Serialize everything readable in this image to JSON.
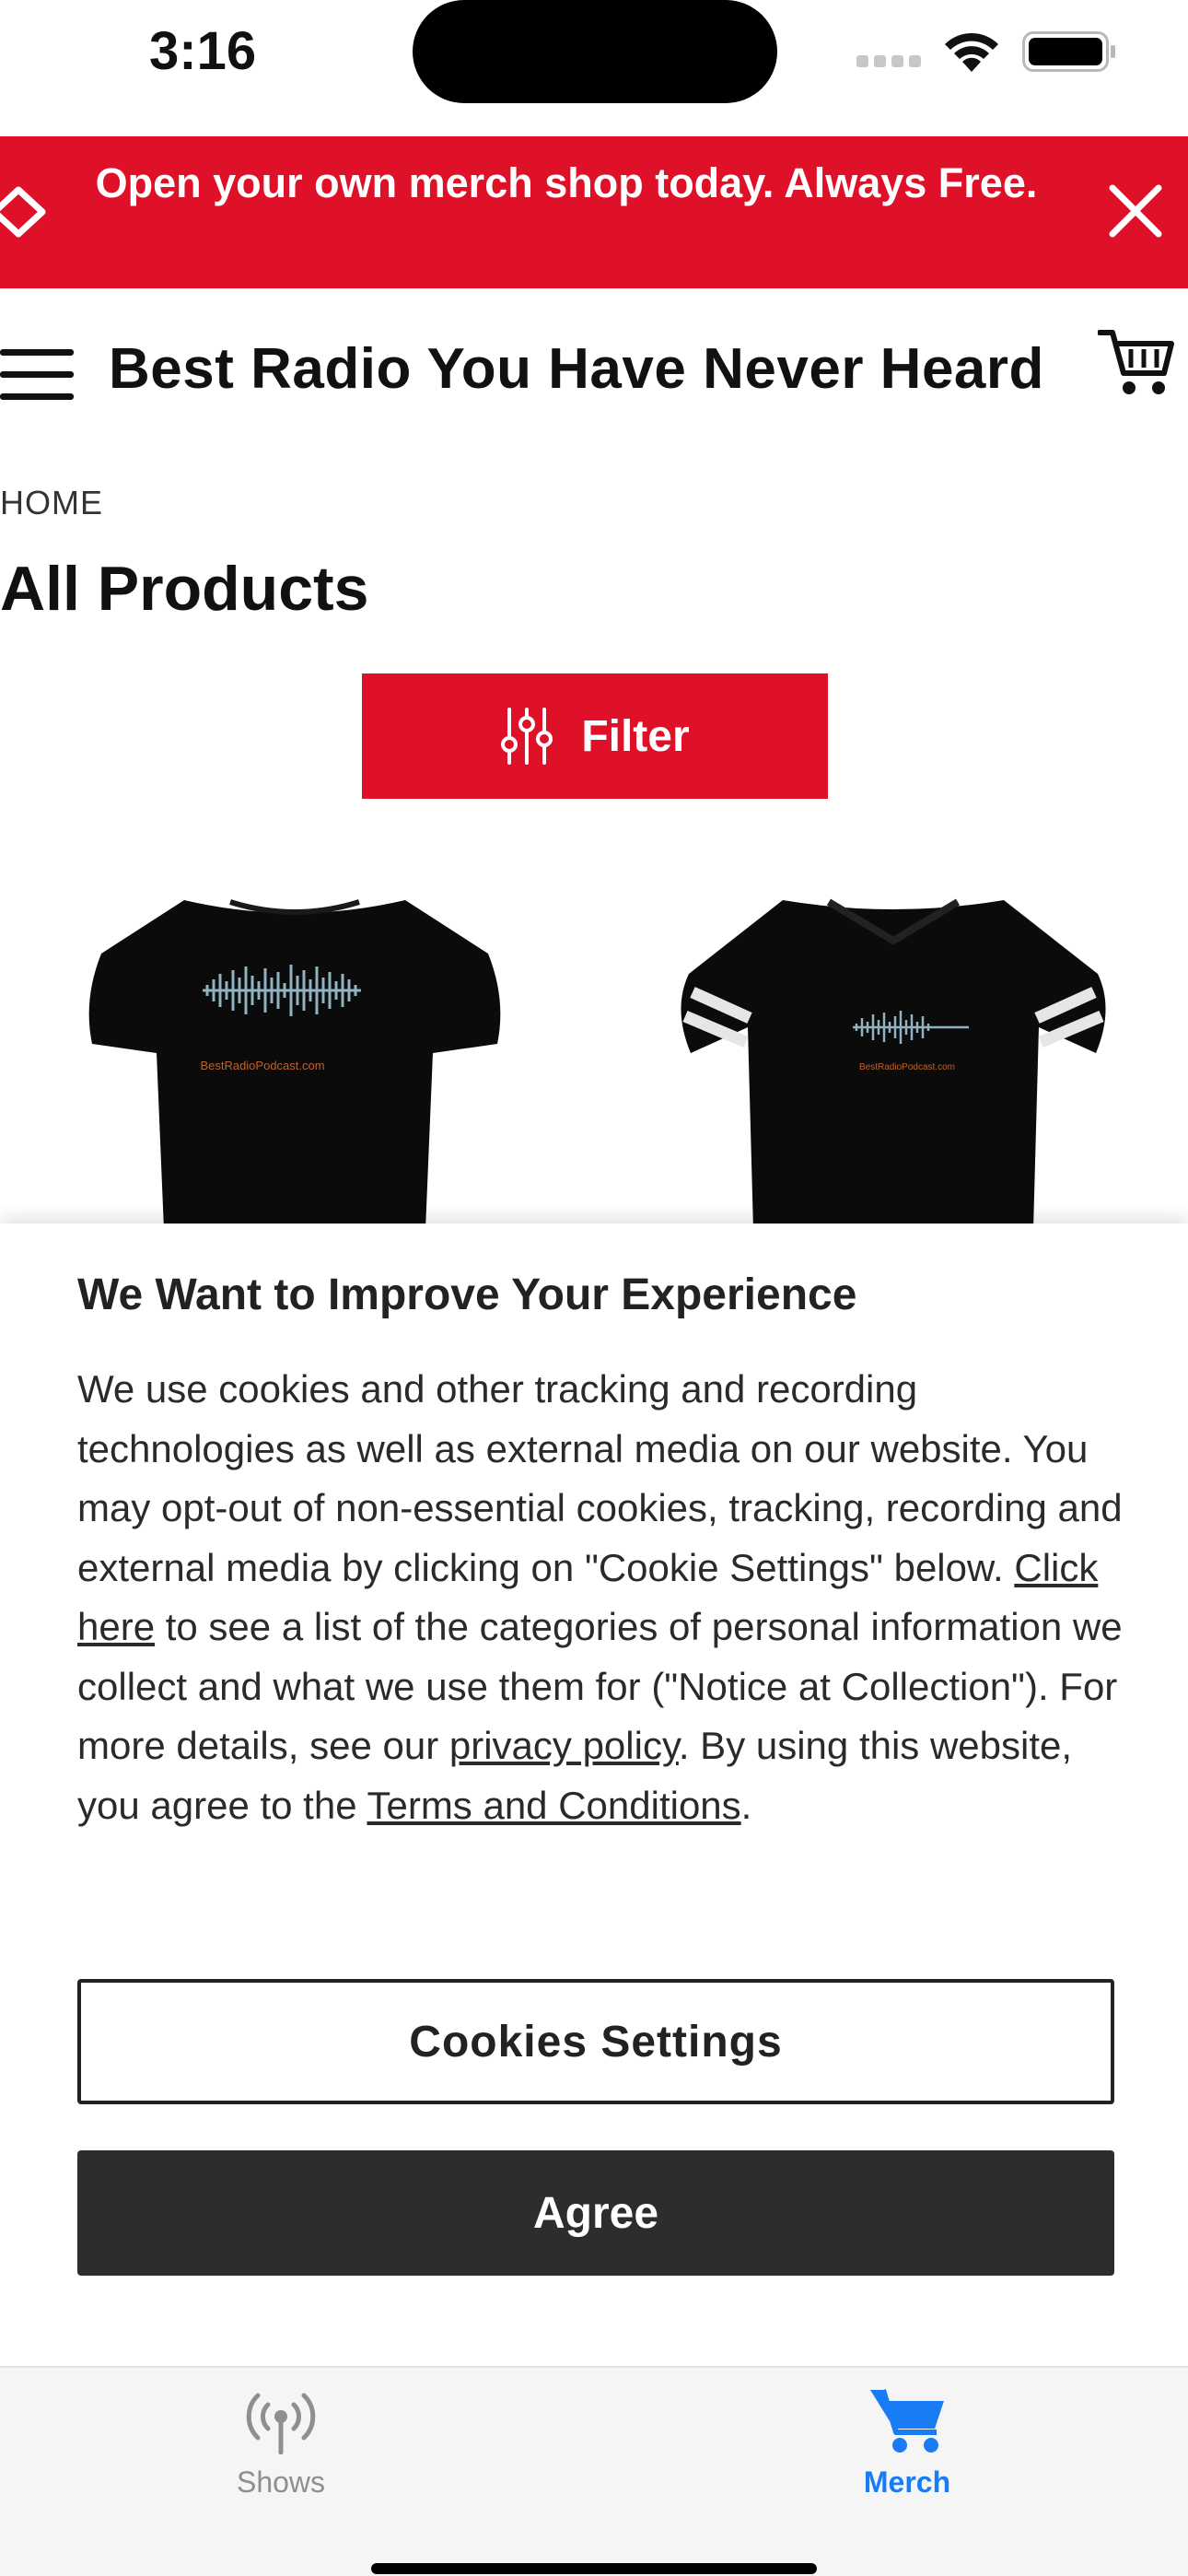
{
  "status_bar": {
    "time": "3:16"
  },
  "promo_banner": {
    "text": "Open your own merch shop today. Always Free.",
    "icon": "heart-outline-icon",
    "close_icon": "close-icon",
    "background": "#de1128"
  },
  "header": {
    "title": "Best Radio You Have Never Heard",
    "menu_icon": "hamburger-menu-icon",
    "cart_icon": "shopping-cart-icon"
  },
  "breadcrumb": "HOME",
  "page_title": "All Products",
  "filter": {
    "label": "Filter",
    "icon": "sliders-icon",
    "color": "#de1128"
  },
  "products": [
    {
      "image": "black-tshirt",
      "print_text": "BestRadioPodcast.com"
    },
    {
      "image": "black-striped-sleeve-tshirt",
      "print_text": "BestRadioPodcast.com"
    }
  ],
  "cookie_banner": {
    "title": "We Want to Improve Your Experience",
    "body_1": "We use cookies and other tracking and recording technologies as well as external media on our website. You may opt-out of non-essential cookies, tracking, recording and external media by clicking on \"Cookie Settings\" below. ",
    "link_click_here": "Click here",
    "body_2": " to see a list of the categories of personal information we collect and what we use them for (\"Notice at Collection\"). For more details, see our ",
    "link_privacy": "privacy policy",
    "body_3": ". By using this website, you agree to the ",
    "link_terms": "Terms and Conditions",
    "body_4": ".",
    "settings_button": "Cookies Settings",
    "agree_button": "Agree"
  },
  "tab_bar": {
    "tabs": [
      {
        "label": "Shows",
        "icon": "broadcast-antenna-icon",
        "active": false
      },
      {
        "label": "Merch",
        "icon": "shopping-cart-icon",
        "active": true
      }
    ],
    "active_color": "#1a7cf5",
    "inactive_color": "#8e8e93"
  }
}
